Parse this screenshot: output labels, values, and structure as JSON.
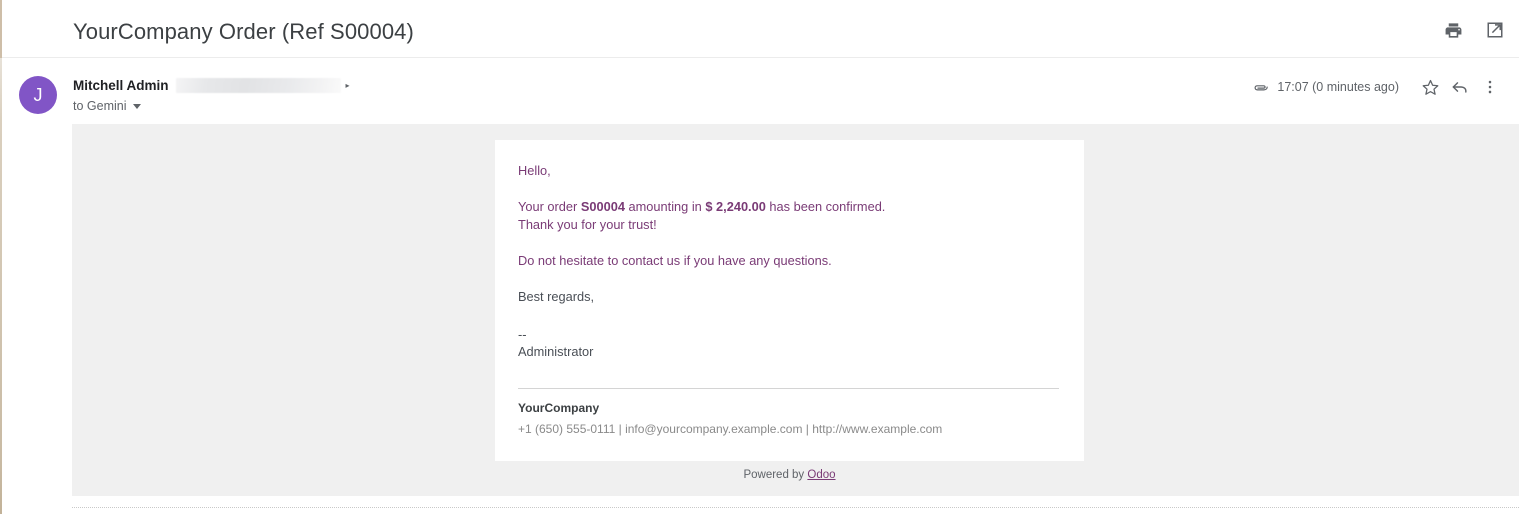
{
  "header": {
    "title": "YourCompany Order (Ref S00004)",
    "print_icon": "print-icon",
    "open_new_window_icon": "open-in-new-icon"
  },
  "sender": {
    "name": "Mitchell Admin",
    "email_redacted": "",
    "expand_caret": "▸",
    "recipient_label": "to Gemini",
    "avatar_initial": "J"
  },
  "meta": {
    "attachment_icon": "paperclip-icon",
    "timestamp": "17:07 (0 minutes ago)",
    "star_icon": "star-icon",
    "reply_icon": "reply-icon",
    "more_icon": "more-vertical-icon"
  },
  "message": {
    "greeting": "Hello,",
    "order_line_prefix": "Your order ",
    "order_ref": "S00004",
    "order_line_middle": " amounting in ",
    "order_amount": "$ 2,240.00",
    "order_line_suffix": " has been confirmed.",
    "thanks": "Thank you for your trust!",
    "contact": "Do not hesitate to contact us if you have any questions.",
    "regards": "Best regards,",
    "dash": "--",
    "signer": "Administrator"
  },
  "signature": {
    "company": "YourCompany",
    "contact_line": "+1 (650) 555-0111 | info@yourcompany.example.com | http://www.example.com"
  },
  "footer": {
    "powered_by": "Powered by ",
    "brand": "Odoo"
  },
  "colors": {
    "accent_purple": "#7a3b76",
    "avatar_purple": "#8155c6",
    "body_gray_bg": "#f0f0f0",
    "text_dark": "#3c4043",
    "text_muted": "#5f6368"
  }
}
